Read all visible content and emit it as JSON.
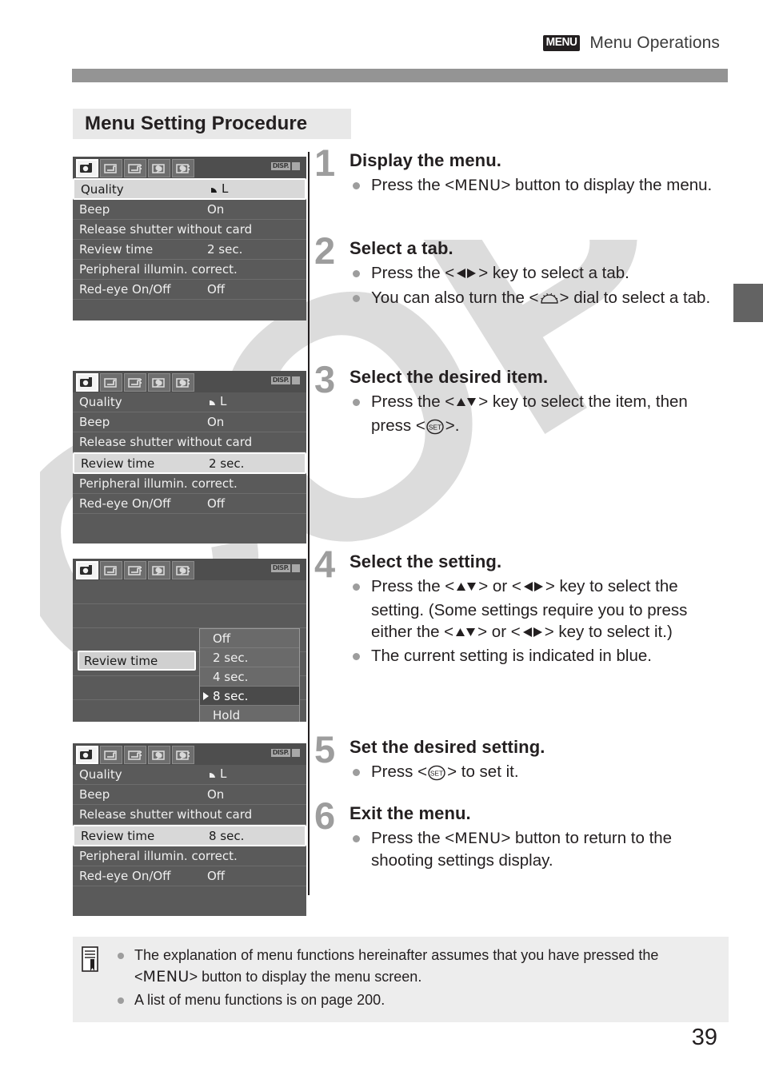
{
  "page": {
    "number": "39",
    "header_badge": "MENU",
    "header_title": "Menu Operations",
    "section_heading": "Menu Setting Procedure"
  },
  "lcd_common": {
    "disp_label": "DISP.",
    "tabs": [
      {
        "name": "shooting-tab-1",
        "icon": "camera-icon",
        "active": true
      },
      {
        "name": "shooting-tab-2",
        "icon": "playback-icon-1",
        "active": false
      },
      {
        "name": "shooting-tab-3",
        "icon": "playback-icon-2",
        "active": false
      },
      {
        "name": "setup-tab-1",
        "icon": "wrench-icon-1",
        "active": false
      },
      {
        "name": "setup-tab-2",
        "icon": "wrench-icon-2",
        "active": false
      }
    ],
    "rows": {
      "quality": "Quality",
      "quality_value": "L",
      "beep": "Beep",
      "beep_value": "On",
      "release_shutter": "Release shutter without card",
      "release_shutter_value": "",
      "review_time": "Review time",
      "review_time_value_2": "2 sec.",
      "review_time_value_8": "8 sec.",
      "peripheral": "Peripheral illumin. correct.",
      "peripheral_value": "",
      "redeye": "Red-eye On/Off",
      "redeye_value": "Off"
    }
  },
  "lcd_submenu": {
    "label": "Review time",
    "options": [
      {
        "text": "Off",
        "current": false
      },
      {
        "text": "2 sec.",
        "current": false
      },
      {
        "text": "4 sec.",
        "current": false
      },
      {
        "text": "8 sec.",
        "current": true
      },
      {
        "text": "Hold",
        "current": false
      }
    ]
  },
  "steps": [
    {
      "num": "1",
      "title": "Display the menu.",
      "bullets": [
        {
          "parts": [
            {
              "t": "text",
              "v": "Press the <"
            },
            {
              "t": "menu",
              "v": "MENU"
            },
            {
              "t": "text",
              "v": "> button to display the menu."
            }
          ]
        }
      ]
    },
    {
      "num": "2",
      "title": "Select a tab.",
      "bullets": [
        {
          "parts": [
            {
              "t": "text",
              "v": "Press the <"
            },
            {
              "t": "dpad-lr",
              "v": "◀▶"
            },
            {
              "t": "text",
              "v": "> key to select a tab."
            }
          ]
        },
        {
          "parts": [
            {
              "t": "text",
              "v": "You can also turn the <"
            },
            {
              "t": "dial",
              "v": "main-dial"
            },
            {
              "t": "text",
              "v": "> dial to select a tab."
            }
          ]
        }
      ]
    },
    {
      "num": "3",
      "title": "Select the desired item.",
      "bullets": [
        {
          "parts": [
            {
              "t": "text",
              "v": "Press the <"
            },
            {
              "t": "dpad-ud",
              "v": "▲▼"
            },
            {
              "t": "text",
              "v": "> key to select the item, then press <"
            },
            {
              "t": "set",
              "v": "SET"
            },
            {
              "t": "text",
              "v": ">."
            }
          ]
        }
      ]
    },
    {
      "num": "4",
      "title": "Select the setting.",
      "bullets": [
        {
          "parts": [
            {
              "t": "text",
              "v": "Press the <"
            },
            {
              "t": "dpad-ud",
              "v": "▲▼"
            },
            {
              "t": "text",
              "v": "> or <"
            },
            {
              "t": "dpad-lr",
              "v": "◀▶"
            },
            {
              "t": "text",
              "v": "> key to select the setting. (Some settings require you to press either the <"
            },
            {
              "t": "dpad-ud",
              "v": "▲▼"
            },
            {
              "t": "text",
              "v": "> or <"
            },
            {
              "t": "dpad-lr",
              "v": "◀▶"
            },
            {
              "t": "text",
              "v": "> key to select it.)"
            }
          ]
        },
        {
          "parts": [
            {
              "t": "text",
              "v": "The current setting is indicated in blue."
            }
          ]
        }
      ]
    },
    {
      "num": "5",
      "title": "Set the desired setting.",
      "bullets": [
        {
          "parts": [
            {
              "t": "text",
              "v": "Press <"
            },
            {
              "t": "set",
              "v": "SET"
            },
            {
              "t": "text",
              "v": "> to set it."
            }
          ]
        }
      ]
    },
    {
      "num": "6",
      "title": "Exit the menu.",
      "bullets": [
        {
          "parts": [
            {
              "t": "text",
              "v": "Press the <"
            },
            {
              "t": "menu",
              "v": "MENU"
            },
            {
              "t": "text",
              "v": "> button to return to the shooting settings display."
            }
          ]
        }
      ]
    }
  ],
  "note_box": {
    "icon": "note-memo-icon",
    "bullets": [
      {
        "parts": [
          {
            "t": "text",
            "v": "The explanation of menu functions hereinafter assumes that you have pressed the <"
          },
          {
            "t": "menu",
            "v": "MENU"
          },
          {
            "t": "text",
            "v": "> button to display the menu screen."
          }
        ]
      },
      {
        "parts": [
          {
            "t": "text",
            "v": "A list of menu functions is on page 200."
          }
        ]
      }
    ]
  },
  "watermark": {
    "text": "COPY",
    "color": "#dcdcdc"
  },
  "colors": {
    "header_rule": "#949494",
    "section_bg": "#e8e8e8",
    "step_number": "#9d9d9d",
    "note_bg": "#ededed",
    "lcd_bg": "#5a5a5a",
    "thumb_tab": "#636363"
  }
}
